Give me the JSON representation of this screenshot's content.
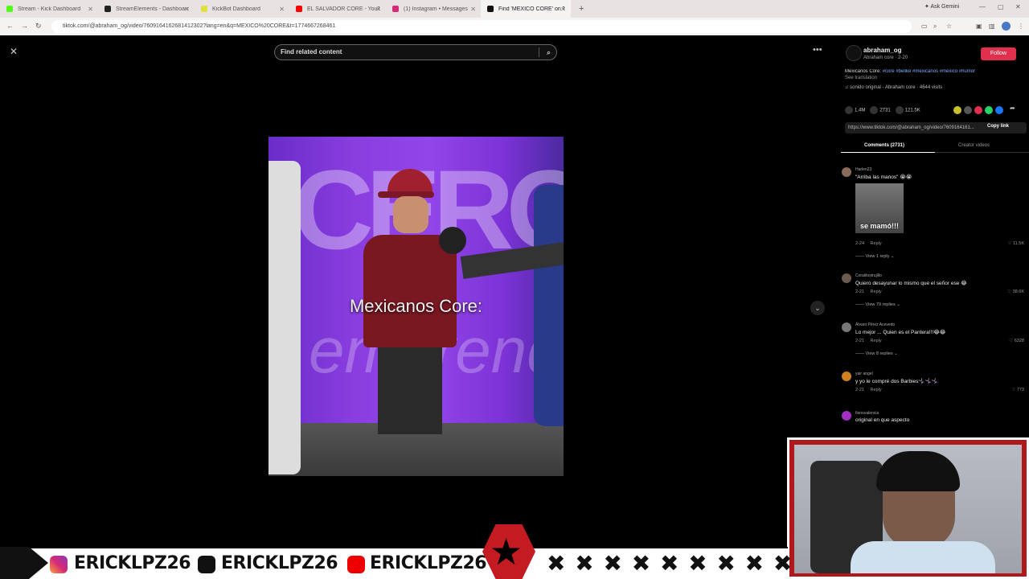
{
  "browser": {
    "tabs": [
      {
        "label": "Stream - Kick Dashboard",
        "color": "#53fc18",
        "active": false
      },
      {
        "label": "StreamElements - Dashboard",
        "color": "#222222",
        "active": false
      },
      {
        "label": "KickBot Dashboard",
        "color": "#e0e040",
        "active": false
      },
      {
        "label": "EL SALVADOR CORE - YouTube",
        "color": "#ff0000",
        "active": false
      },
      {
        "label": "(1) Instagram • Messages",
        "color": "#d62976",
        "active": false
      },
      {
        "label": "Find 'MEXICO CORE' on TikTok",
        "color": "#111111",
        "active": true
      }
    ],
    "new_tab": "+",
    "ask_gemini": "Ask Gemini",
    "url": "tiktok.com/@abraham_og/video/7609164162681412302?lang=en&q=MEXICO%20CORE&t=1774667268461"
  },
  "page": {
    "search_placeholder": "Find related content",
    "video_caption": "Mexicanos Core:",
    "bg_text_1": "CERO",
    "bg_text_2": "emprend"
  },
  "author": {
    "username": "abraham_og",
    "subtitle": "Abraham core · 2-20",
    "follow_label": "Follow",
    "description_prefix": "Mexicanos Core: ",
    "description_tags": "#core #belike #mexicanos #mexico #humor",
    "see_translation": "See translation",
    "music": "♫ sonido original - Abraham core · 4644 visits"
  },
  "stats": {
    "likes": "1.4M",
    "comments": "2731",
    "saves": "121.5K"
  },
  "share_link": "https://www.tiktok.com/@abraham_og/video/7609164161...",
  "copy_link_label": "Copy link",
  "panel_tabs": {
    "comments": "Comments (2731)",
    "creator": "Creator videos"
  },
  "comments": [
    {
      "user": "Harlen23",
      "text": "\"Arriba las manos\" 😭😭",
      "date": "2-24",
      "reply": "Reply",
      "likes": "11.5K",
      "replies": "View 1 reply",
      "gif_text": "se mamó!!!"
    },
    {
      "user": "Coralitostrujillo",
      "text": "Quiero desayunar lo mismo que el señor ese 😂",
      "date": "2-21",
      "reply": "Reply",
      "likes": "38.6K",
      "replies": "View 79 replies"
    },
    {
      "user": "Álvaro Pérez Acevedo",
      "text": "Lo mejor ... Quien es el Pantera!!!😂😂",
      "date": "2-21",
      "reply": "Reply",
      "likes": "6328",
      "replies": "View 8 replies"
    },
    {
      "user": "yair angel",
      "text": "y yo le compré dos Barbies🤸🏻‍♀️🤸🏻‍♀️🤸🏻‍♀️",
      "date": "2-21",
      "reply": "Reply",
      "likes": "773"
    },
    {
      "user": "Itsnovalencia",
      "text": "original en que aspecto"
    }
  ],
  "overlay": {
    "handle_instagram": "ERICKLPZ26",
    "handle_tiktok": "ERICKLPZ26",
    "handle_youtube": "ERICKLPZ26",
    "star": "★",
    "xs": "✖ ✖ ✖ ✖ ✖ ✖ ✖ ✖ ✖"
  },
  "colors": {
    "follow": "#e0304e",
    "tag": "#7fb0ff",
    "badge": "#c41a22"
  }
}
